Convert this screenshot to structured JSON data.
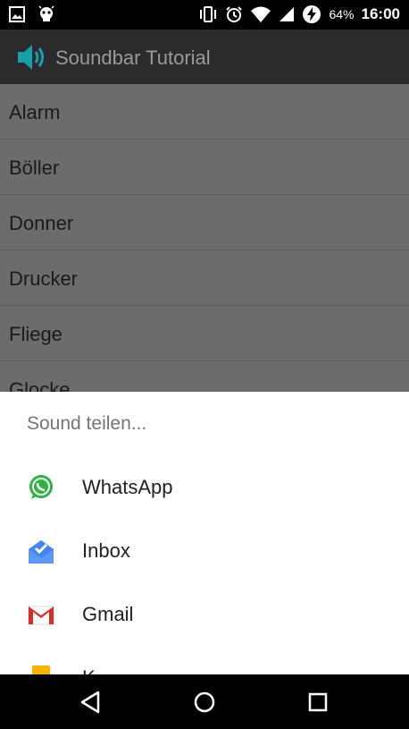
{
  "status_bar": {
    "battery_percent": "64%",
    "time": "16:00",
    "icons": [
      "image-icon",
      "android-debug-icon",
      "vibrate-icon",
      "alarm-icon",
      "wifi-icon",
      "signal-icon",
      "battery-charging-icon"
    ]
  },
  "app_bar": {
    "title": "Soundbar Tutorial",
    "icon": "speaker-icon"
  },
  "sound_list": {
    "items": [
      "Alarm",
      "Böller",
      "Donner",
      "Drucker",
      "Fliege",
      "Glocke"
    ]
  },
  "share_sheet": {
    "title": "Sound teilen...",
    "apps": [
      {
        "label": "WhatsApp",
        "icon": "whatsapp-icon"
      },
      {
        "label": "Inbox",
        "icon": "inbox-icon"
      },
      {
        "label": "Gmail",
        "icon": "gmail-icon"
      },
      {
        "label": "K...",
        "icon": "keep-icon"
      }
    ]
  },
  "nav_bar": {
    "buttons": [
      "back-icon",
      "home-icon",
      "recents-icon"
    ]
  },
  "colors": {
    "status_bar": "#000000",
    "app_bar": "#2b2b2b",
    "scrim_list": "#6c6c6c",
    "sheet": "#ffffff",
    "accent_teal": "#1a9ea8"
  }
}
